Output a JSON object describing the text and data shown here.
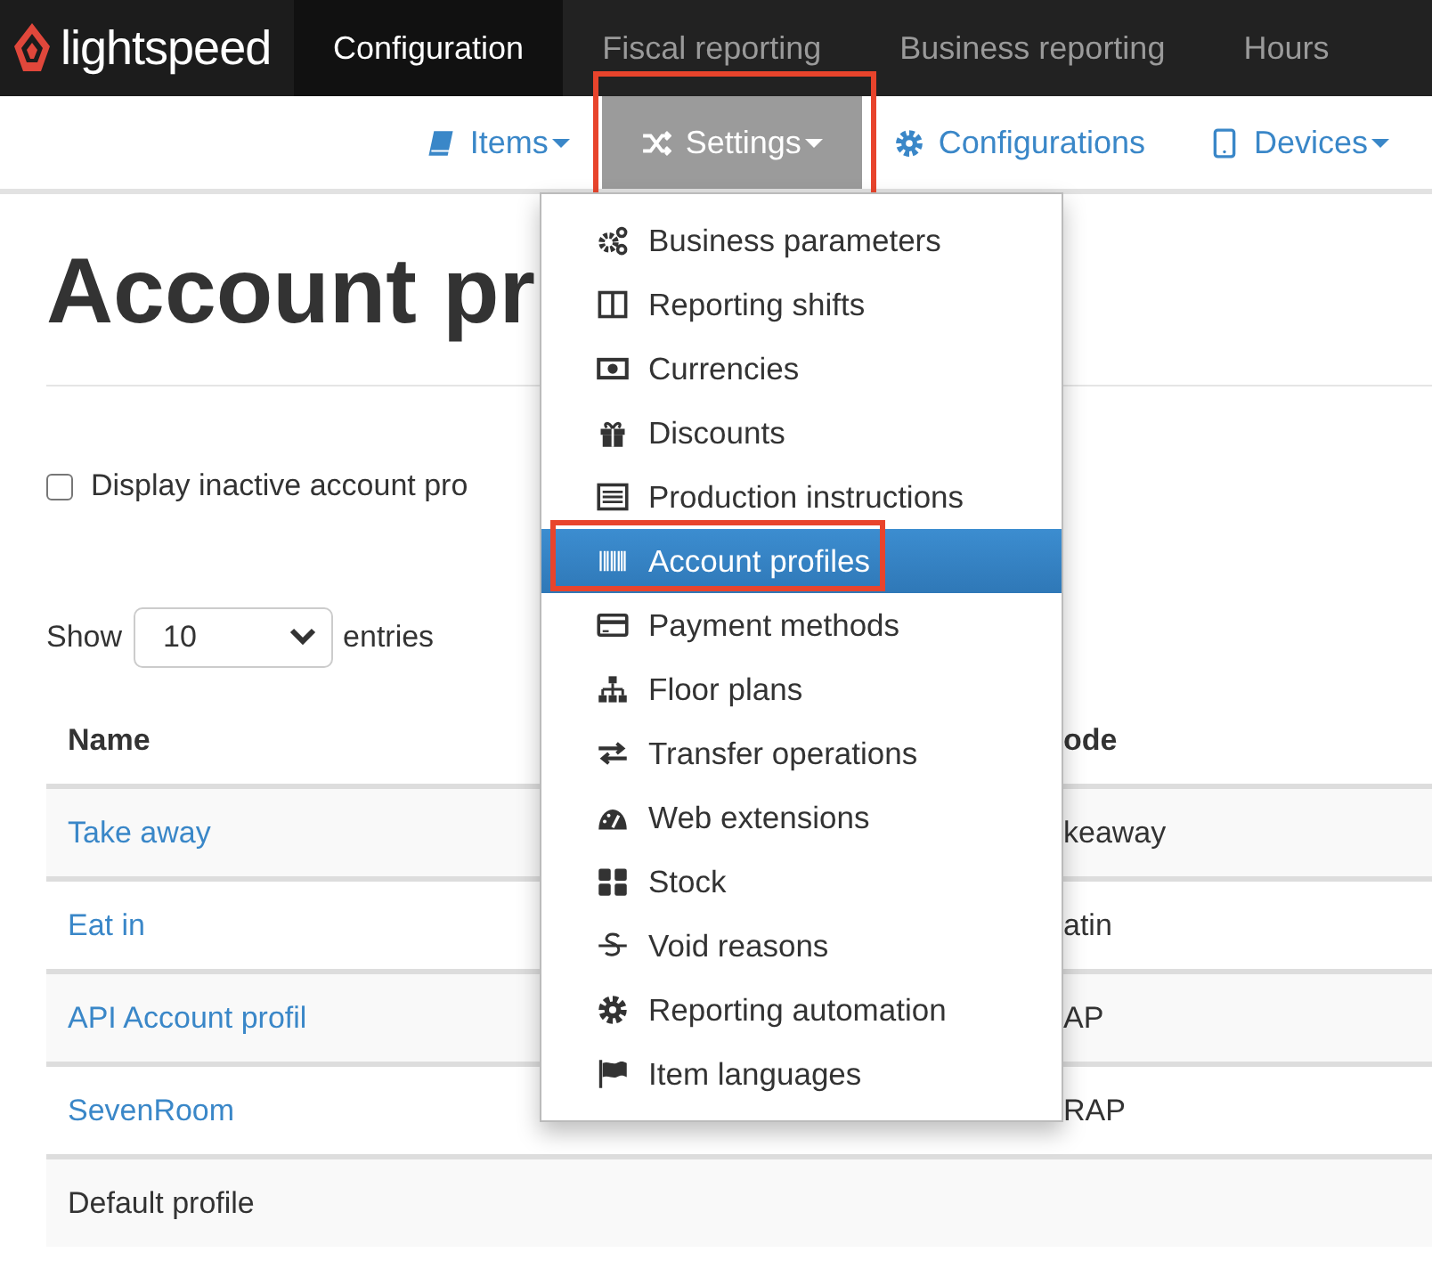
{
  "brand": {
    "name": "lightspeed"
  },
  "top_tabs": [
    {
      "label": "Configuration",
      "selected": true
    },
    {
      "label": "Fiscal reporting",
      "selected": false
    },
    {
      "label": "Business reporting",
      "selected": false
    },
    {
      "label": "Hours",
      "selected": false
    }
  ],
  "sub_nav": [
    {
      "label": "Items",
      "dropdown": true,
      "selected": false,
      "highlighted": false
    },
    {
      "label": "Settings",
      "dropdown": true,
      "selected": true,
      "highlighted": true
    },
    {
      "label": "Configurations",
      "dropdown": false,
      "selected": false,
      "highlighted": false
    },
    {
      "label": "Devices",
      "dropdown": true,
      "selected": false,
      "highlighted": false
    }
  ],
  "page": {
    "title": "Account pr",
    "inactive_checkbox": {
      "label": "Display inactive account pro",
      "checked": false
    },
    "length_menu": {
      "before": "Show",
      "value": "10",
      "after": "entries"
    }
  },
  "table": {
    "columns": [
      "Name",
      "ode"
    ],
    "rows": [
      {
        "cells": [
          "Take away",
          "keaway"
        ],
        "link": true
      },
      {
        "cells": [
          "Eat in",
          "atin"
        ],
        "link": true
      },
      {
        "cells": [
          "API Account profil",
          "AP"
        ],
        "link": true
      },
      {
        "cells": [
          "SevenRoom",
          "RAP"
        ],
        "link": true
      },
      {
        "cells": [
          "Default profile"
        ],
        "link": false
      }
    ]
  },
  "settings_menu": {
    "items": [
      {
        "label": "Business parameters",
        "selected": false,
        "highlighted": false
      },
      {
        "label": "Reporting shifts",
        "selected": false,
        "highlighted": false
      },
      {
        "label": "Currencies",
        "selected": false,
        "highlighted": false
      },
      {
        "label": "Discounts",
        "selected": false,
        "highlighted": false
      },
      {
        "label": "Production instructions",
        "selected": false,
        "highlighted": false
      },
      {
        "label": "Account profiles",
        "selected": true,
        "highlighted": true
      },
      {
        "label": "Payment methods",
        "selected": false,
        "highlighted": false
      },
      {
        "label": "Floor plans",
        "selected": false,
        "highlighted": false
      },
      {
        "label": "Transfer operations",
        "selected": false,
        "highlighted": false
      },
      {
        "label": "Web extensions",
        "selected": false,
        "highlighted": false
      },
      {
        "label": "Stock",
        "selected": false,
        "highlighted": false
      },
      {
        "label": "Void reasons",
        "selected": false,
        "highlighted": false
      },
      {
        "label": "Reporting automation",
        "selected": false,
        "highlighted": false
      },
      {
        "label": "Item languages",
        "selected": false,
        "highlighted": false
      }
    ]
  }
}
